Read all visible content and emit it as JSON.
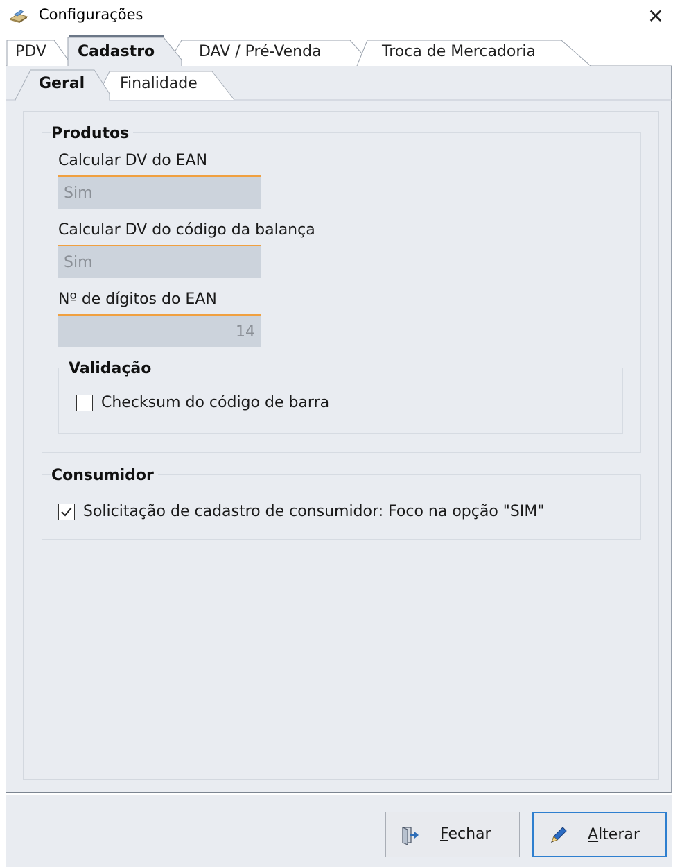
{
  "window": {
    "title": "Configurações",
    "close_glyph": "✕"
  },
  "tabs": [
    {
      "label": "PDV",
      "active": false
    },
    {
      "label": "Cadastro",
      "active": true
    },
    {
      "label": "DAV / Pré-Venda",
      "active": false
    },
    {
      "label": "Troca de Mercadoria",
      "active": false
    }
  ],
  "subtabs": [
    {
      "label": "Geral",
      "active": true
    },
    {
      "label": "Finalidade",
      "active": false
    }
  ],
  "produtos": {
    "title": "Produtos",
    "calc_dv_ean": {
      "label": "Calcular DV do EAN",
      "value": "Sim"
    },
    "calc_dv_balanca": {
      "label": "Calcular DV do código da balança",
      "value": "Sim"
    },
    "digitos_ean": {
      "label": "Nº de dígitos do EAN",
      "value": "14"
    },
    "validacao": {
      "title": "Validação",
      "checksum": {
        "label": "Checksum do código de barra",
        "checked": false
      }
    }
  },
  "consumidor": {
    "title": "Consumidor",
    "solicitacao": {
      "label": "Solicitação de cadastro de consumidor: Foco na opção \"SIM\"",
      "checked": true
    }
  },
  "buttons": {
    "fechar": {
      "label_first": "F",
      "label_rest": "echar",
      "icon": "exit-door-icon"
    },
    "alterar": {
      "label_first": "A",
      "label_rest": "lterar",
      "icon": "pen-icon"
    }
  },
  "colors": {
    "panel_bg": "#e9ecf1",
    "input_bg": "#ccd3dc",
    "focus_line": "#f0a040",
    "primary_border": "#2e7fcf"
  }
}
